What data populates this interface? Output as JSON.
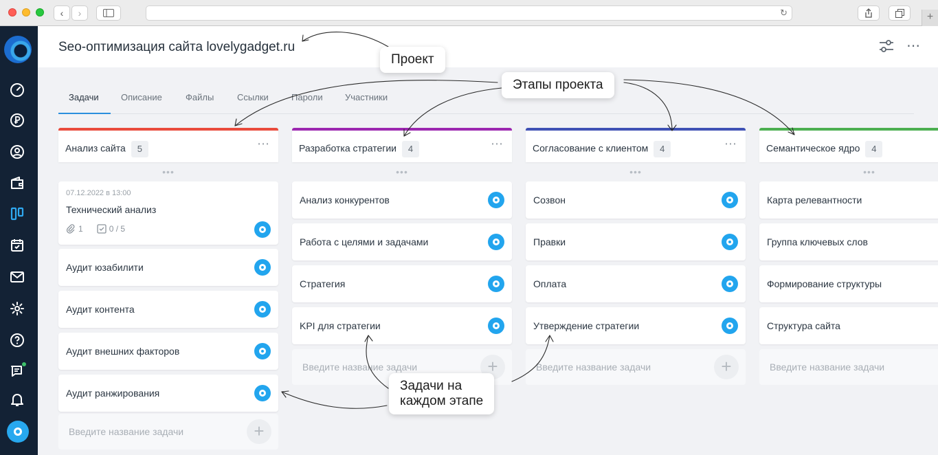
{
  "project": {
    "title": "Seo-оптимизация сайта lovelygadget.ru"
  },
  "tabs": [
    {
      "label": "Задачи",
      "active": true
    },
    {
      "label": "Описание"
    },
    {
      "label": "Файлы"
    },
    {
      "label": "Ссылки"
    },
    {
      "label": "Пароли"
    },
    {
      "label": "Участники"
    }
  ],
  "columns": [
    {
      "title": "Анализ сайта",
      "count": "5",
      "color": "#e94b3c",
      "first_card": {
        "date": "07.12.2022 в 13:00",
        "title": "Технический анализ",
        "attachments": "1",
        "checklist": "0 / 5"
      },
      "cards": [
        "Аудит юзабилити",
        "Аудит контента",
        "Аудит внешних факторов",
        "Аудит ранжирования"
      ],
      "new_task_placeholder": "Введите название задачи"
    },
    {
      "title": "Разработка стратегии",
      "count": "4",
      "color": "#9c27b0",
      "cards": [
        "Анализ конкурентов",
        "Работа с целями и задачами",
        "Стратегия",
        "KPI для стратегии"
      ],
      "new_task_placeholder": "Введите название задачи"
    },
    {
      "title": "Согласование с клиентом",
      "count": "4",
      "color": "#3f51b5",
      "cards": [
        "Созвон",
        "Правки",
        "Оплата",
        "Утверждение стратегии"
      ],
      "new_task_placeholder": "Введите название задачи"
    },
    {
      "title": "Семантическое ядро",
      "count": "4",
      "color": "#4caf50",
      "cards": [
        "Карта релевантности",
        "Группа ключевых слов",
        "Формирование структуры",
        "Структура сайта"
      ],
      "new_task_placeholder": "Введите название задачи"
    }
  ],
  "annotations": {
    "project": "Проект",
    "stages": "Этапы проекта",
    "tasks_line1": "Задачи на",
    "tasks_line2": "каждом этапе"
  },
  "icons": {
    "sidebar": [
      "gauge-icon",
      "ruble-icon",
      "user-icon",
      "wallet-icon",
      "board-icon",
      "calendar-icon",
      "mail-icon",
      "gear-icon",
      "help-icon",
      "chat-icon",
      "bell-icon"
    ],
    "toolbar": [
      "filter-icon",
      "more-icon"
    ]
  },
  "colors": {
    "sidebar": "#132235",
    "accent": "#22a5ee"
  }
}
